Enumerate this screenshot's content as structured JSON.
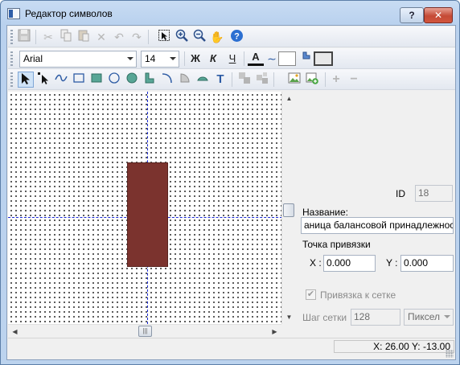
{
  "window": {
    "title": "Редактор символов",
    "help_label": "?",
    "close_label": "✕"
  },
  "toolbar1": {
    "icons": [
      "save-icon",
      "cut-icon",
      "copy-icon",
      "paste-icon",
      "delete-icon",
      "undo-icon",
      "redo-icon",
      "select-area-icon",
      "zoom-in-icon",
      "zoom-out-icon",
      "pan-hand-icon",
      "help-icon"
    ]
  },
  "toolbar2": {
    "font_family": "Arial",
    "font_size": "14",
    "bold_label": "Ж",
    "italic_label": "К",
    "underline_label": "Ч",
    "font_color_label": "A"
  },
  "toolbar3": {
    "icons": [
      "pointer-tool-icon",
      "node-edit-tool-icon",
      "curve-tool-icon",
      "rectangle-tool-icon",
      "filled-rectangle-tool-icon",
      "ellipse-tool-icon",
      "filled-ellipse-tool-icon",
      "polygon-tool-icon",
      "arc-tool-icon",
      "pie-tool-icon",
      "chord-tool-icon",
      "text-tool-icon",
      "group-icon",
      "ungroup-icon",
      "image-icon",
      "add-image-icon",
      "add-icon",
      "remove-icon"
    ],
    "text_tool_label": "T"
  },
  "colors": {
    "shape_fill": "#7b332e",
    "guide_line": "#1b2bd6",
    "accent": "#2f5fa8"
  },
  "properties": {
    "id_label": "ID",
    "id_value": "18",
    "name_label": "Название:",
    "name_value": "аница балансовой принадлежности",
    "anchor_label": "Точка привязки",
    "x_label": "X :",
    "x_value": "0.000",
    "y_label": "Y :",
    "y_value": "0.000",
    "snap_label": "Привязка к сетке",
    "snap_checked": true,
    "grid_step_label": "Шаг сетки",
    "grid_step_value": "128",
    "grid_unit": "Пиксел"
  },
  "status": {
    "coords": "X: 26.00  Y: -13.00"
  }
}
